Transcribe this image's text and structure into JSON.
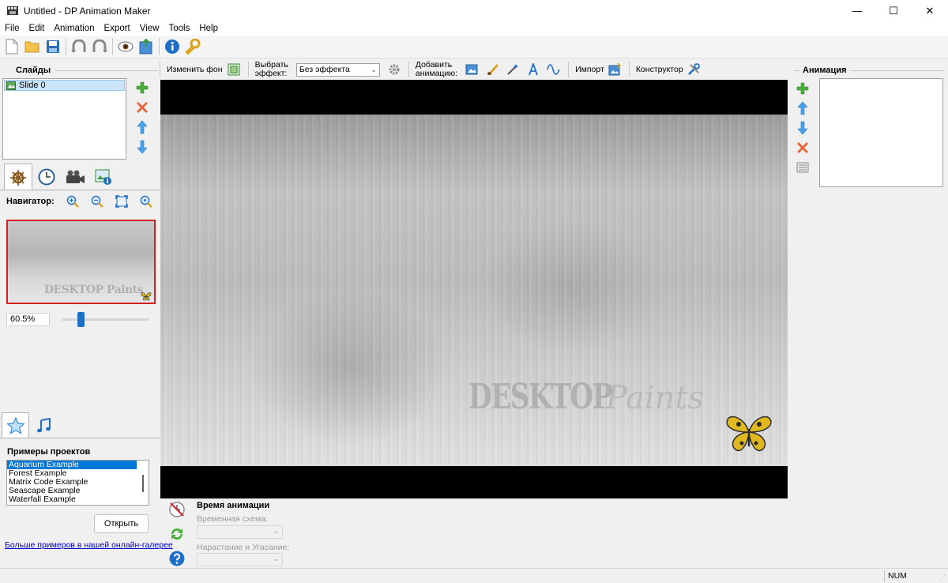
{
  "window": {
    "title": "Untitled - DP Animation Maker",
    "minimize": "—",
    "maximize": "☐",
    "close": "✕"
  },
  "menu": [
    "File",
    "Edit",
    "Animation",
    "Export",
    "View",
    "Tools",
    "Help"
  ],
  "slides_panel": {
    "title": "Слайды",
    "items": [
      "Slide 0"
    ]
  },
  "navigator": {
    "label": "Навигатор:",
    "zoom_value": "60.5%",
    "zoom_slider_fraction": 0.2,
    "preview_watermark": "DESKTOP Paints"
  },
  "center_toolbar": {
    "change_bg": "Изменить фон",
    "select_effect_line1": "Выбрать",
    "select_effect_line2": "эффект:",
    "effect_value": "Без эффекта",
    "add_anim_line1": "Добавить",
    "add_anim_line2": "анимацию:",
    "import": "Импорт",
    "constructor": "Конструктор"
  },
  "canvas": {
    "watermark_desktop": "DESKTOP",
    "watermark_paints": "Paints"
  },
  "examples": {
    "title": "Примеры проектов",
    "items": [
      "Aquarium Example",
      "Forest Example",
      "Matrix Code Example",
      "Seascape Example",
      "Waterfall Example"
    ],
    "selected_index": 0,
    "open_button": "Открыть",
    "gallery_link": "Больше примеров в нашей онлайн-галерее"
  },
  "animation_time": {
    "title": "Время анимации",
    "scheme_label": "Временная схема:",
    "fade_label": "Нарастание и Угасание:"
  },
  "animation_panel": {
    "title": "Анимация"
  },
  "statusbar": {
    "num": "NUM"
  },
  "colors": {
    "accent": "#0078d7",
    "preview_border": "#d02020",
    "slider_thumb": "#1f6fc5",
    "selection_bg": "#cce4f7"
  }
}
